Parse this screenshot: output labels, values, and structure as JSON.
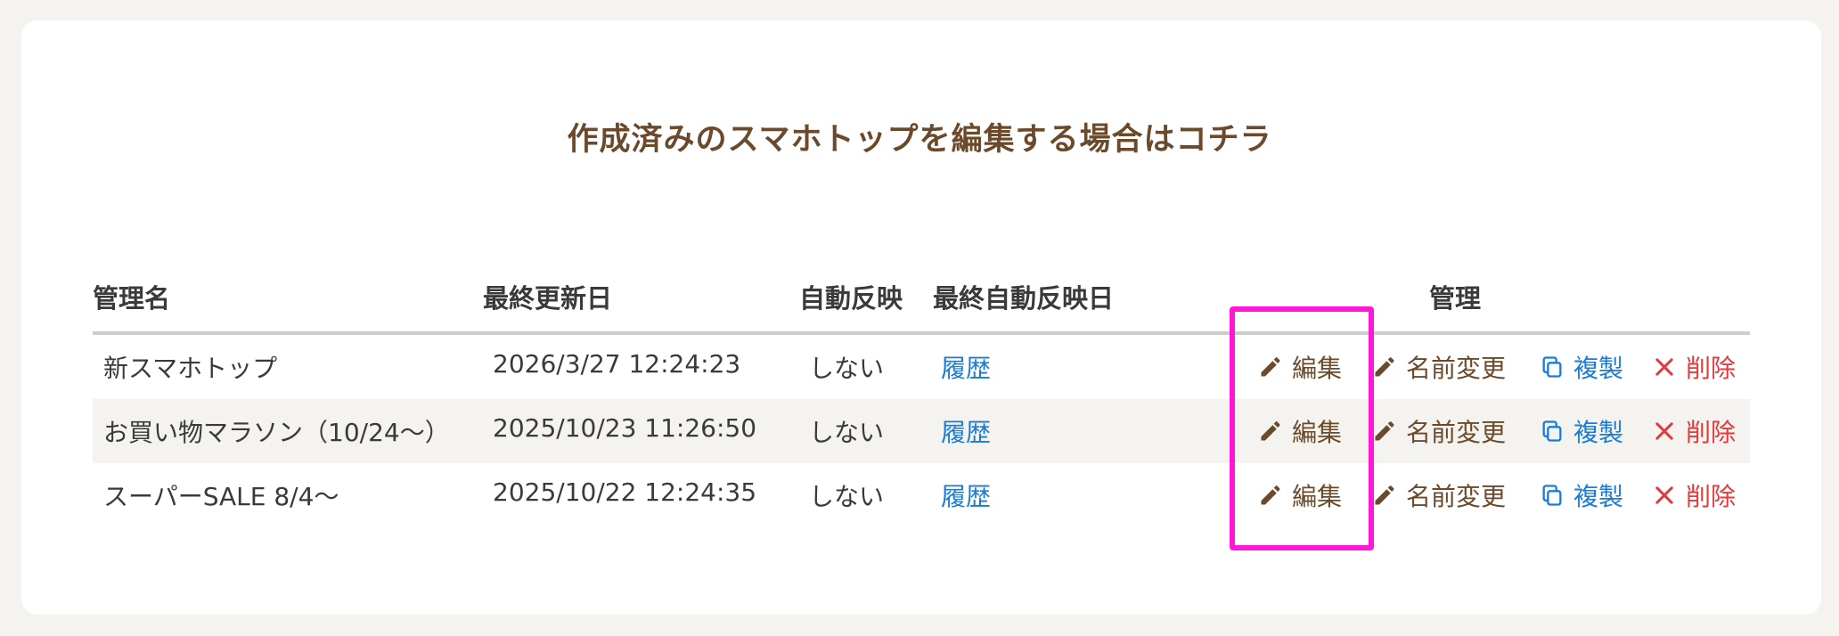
{
  "heading": "作成済みのスマホトップを編集する場合はコチラ",
  "columns": {
    "name": "管理名",
    "updated": "最終更新日",
    "auto": "自動反映",
    "auto_date": "最終自動反映日",
    "manage": "管理"
  },
  "rows": [
    {
      "name": "新スマホトップ",
      "updated": "2026/3/27 12:24:23",
      "auto": "しない",
      "history": "履歴"
    },
    {
      "name": "お買い物マラソン（10/24〜）",
      "updated": "2025/10/23 11:26:50",
      "auto": "しない",
      "history": "履歴"
    },
    {
      "name": "スーパーSALE 8/4〜",
      "updated": "2025/10/22 12:24:35",
      "auto": "しない",
      "history": "履歴"
    }
  ],
  "actions": {
    "edit": "編集",
    "rename": "名前変更",
    "copy": "複製",
    "delete": "削除"
  },
  "icons": {
    "edit": "pencil-icon",
    "rename": "pencil-icon",
    "copy": "copy-icon",
    "delete": "close-icon"
  },
  "colors": {
    "heading": "#6b4a2b",
    "link": "#1a7cd6",
    "delete": "#e23b3b",
    "highlight": "#ff17d8"
  }
}
